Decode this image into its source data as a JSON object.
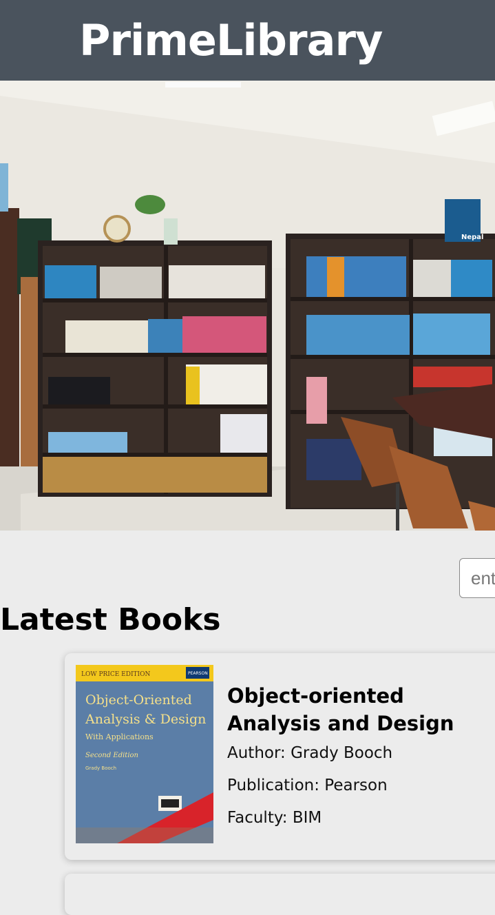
{
  "header": {
    "brand": "PrimeLibrary"
  },
  "hero": {
    "image": "library-bookshelves-photo",
    "sign_text": "Nepal"
  },
  "search": {
    "placeholder": "enter"
  },
  "latest": {
    "title": "Latest Books",
    "books": [
      {
        "title": "Object-oriented Analysis and Design",
        "author": "Author: Grady Booch",
        "publication": "Publication: Pearson",
        "faculty": "Faculty: BIM",
        "cover": {
          "banner": "LOW PRICE EDITION",
          "publisher": "PEARSON",
          "title_line1": "Object-Oriented",
          "title_line2": "Analysis & Design",
          "subtitle": "With Applications",
          "edition": "Second Edition",
          "author": "Grady Booch"
        }
      }
    ]
  },
  "colors": {
    "header_bg": "#4a535d",
    "page_bg": "#ececec",
    "cover_blue": "#5a7fa8",
    "cover_yellow": "#f3c81c"
  }
}
